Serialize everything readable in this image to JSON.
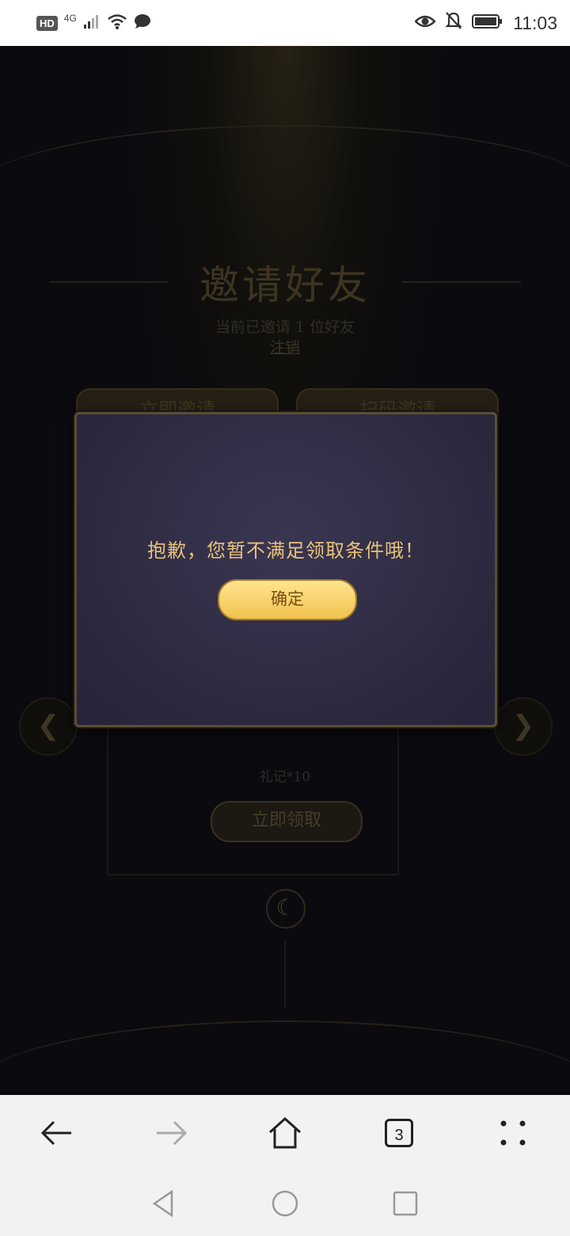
{
  "status_bar": {
    "hd_label": "HD",
    "signal_label": "4G",
    "time": "11:03"
  },
  "page": {
    "title": "邀请好友",
    "invite_count_text": "当前已邀请 1 位好友",
    "logout_link": "注销",
    "tabs": [
      {
        "label": "立即邀请"
      },
      {
        "label": "扫码邀请"
      }
    ],
    "reward_label": "礼记*10",
    "claim_button": "立即领取"
  },
  "dialog": {
    "message": "抱歉，您暂不满足领取条件哦！",
    "confirm_label": "确定"
  },
  "browser": {
    "tabs_count": "3"
  },
  "colors": {
    "accent_gold": "#e8c27a",
    "button_gold": "#f1c24e",
    "dialog_bg": "#2c293f"
  }
}
